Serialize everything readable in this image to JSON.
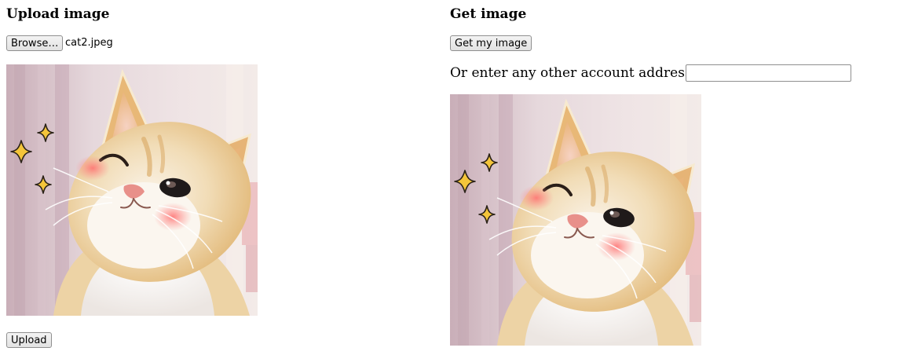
{
  "upload": {
    "heading": "Upload image",
    "browse_label": "Browse…",
    "filename": "cat2.jpeg",
    "upload_label": "Upload"
  },
  "get": {
    "heading": "Get my image",
    "title": "Get image",
    "address_label": "Or enter any other account address:",
    "address_value": ""
  }
}
